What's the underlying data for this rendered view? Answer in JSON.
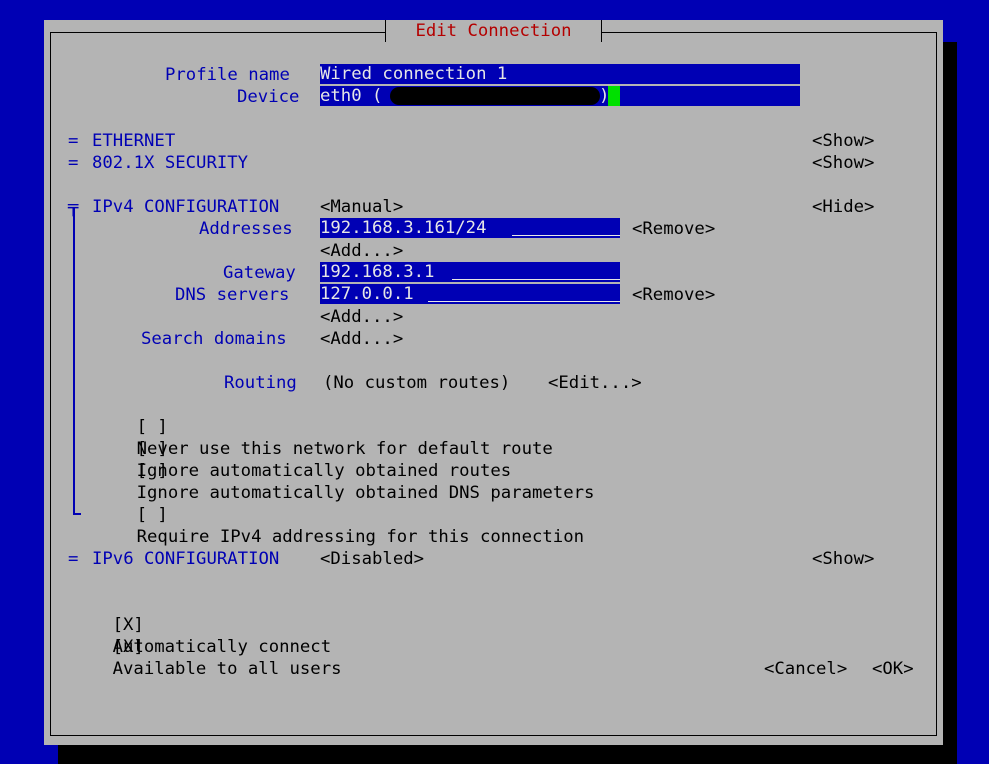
{
  "dialog": {
    "title": "Edit Connection"
  },
  "profile": {
    "profile_name_label": "Profile name",
    "profile_name_value": "Wired connection 1",
    "device_label": "Device",
    "device_value_prefix": "eth0 (",
    "device_value_suffix": ")"
  },
  "sections": {
    "ethernet": {
      "marker": "=",
      "title": "ETHERNET",
      "toggle": "<Show>"
    },
    "security": {
      "marker": "=",
      "title": "802.1X SECURITY",
      "toggle": "<Show>"
    },
    "ipv4": {
      "marker": "╤",
      "title": "IPv4 CONFIGURATION",
      "method": "<Manual>",
      "toggle": "<Hide>"
    },
    "ipv6": {
      "marker": "=",
      "title": "IPv6 CONFIGURATION",
      "method": "<Disabled>",
      "toggle": "<Show>"
    }
  },
  "ipv4": {
    "addresses_label": "Addresses",
    "address_value": "192.168.3.161/24",
    "remove_label": "<Remove>",
    "add_label": "<Add...>",
    "gateway_label": "Gateway",
    "gateway_value": "192.168.3.1",
    "dns_label": "DNS servers",
    "dns_value": "127.0.0.1",
    "search_domains_label": "Search domains",
    "routing_label": "Routing",
    "routing_value": "(No custom routes)",
    "routing_edit": "<Edit...>",
    "checkboxes": [
      {
        "box": "[ ]",
        "label": "Never use this network for default route"
      },
      {
        "box": "[ ]",
        "label": "Ignore automatically obtained routes"
      },
      {
        "box": "[ ]",
        "label": "Ignore automatically obtained DNS parameters"
      },
      {
        "box": "[ ]",
        "label": "Require IPv4 addressing for this connection"
      }
    ]
  },
  "general": {
    "checkboxes": [
      {
        "box": "[X]",
        "label": "Automatically connect"
      },
      {
        "box": "[X]",
        "label": "Available to all users"
      }
    ]
  },
  "buttons": {
    "cancel": "<Cancel>",
    "ok": "<OK>"
  },
  "colors": {
    "background": "#0000b4",
    "dialog": "#b4b4b4",
    "title": "#b40000",
    "field": "#0000b4",
    "cursor": "#00e000"
  }
}
